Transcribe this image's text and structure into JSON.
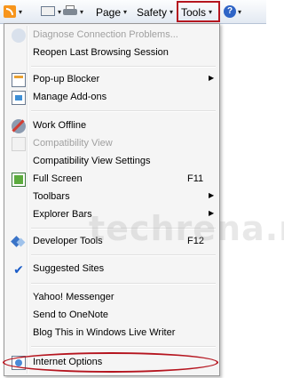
{
  "commandbar": {
    "page_label": "Page",
    "safety_label": "Safety",
    "tools_label": "Tools",
    "dropdown_arrow": "▾",
    "help_glyph": "?",
    "highlight_color": "#b5151f"
  },
  "menu": {
    "items": [
      {
        "label": "Diagnose Connection Problems...",
        "icon": "diagnose-icon",
        "disabled": true
      },
      {
        "label": "Reopen Last Browsing Session",
        "icon": null
      },
      {
        "label": "Pop-up Blocker",
        "icon": "popup-blocker-icon",
        "submenu": true
      },
      {
        "label": "Manage Add-ons",
        "icon": "manage-addons-icon"
      },
      {
        "label": "Work Offline",
        "icon": "work-offline-icon"
      },
      {
        "label": "Compatibility View",
        "icon": "compatibility-view-icon",
        "disabled": true
      },
      {
        "label": "Compatibility View Settings",
        "icon": null
      },
      {
        "label": "Full Screen",
        "icon": "full-screen-icon",
        "shortcut": "F11"
      },
      {
        "label": "Toolbars",
        "icon": null,
        "submenu": true
      },
      {
        "label": "Explorer Bars",
        "icon": null,
        "submenu": true
      },
      {
        "label": "Developer Tools",
        "icon": "developer-tools-icon",
        "shortcut": "F12"
      },
      {
        "label": "Suggested Sites",
        "icon": "check-icon",
        "checked": true
      },
      {
        "label": "Yahoo! Messenger",
        "icon": null
      },
      {
        "label": "Send to OneNote",
        "icon": null
      },
      {
        "label": "Blog This in Windows Live Writer",
        "icon": null
      },
      {
        "label": "Internet Options",
        "icon": "internet-options-icon",
        "highlighted": true
      }
    ],
    "submenu_arrow": "▶",
    "check_glyph": "✔"
  },
  "watermark": "techrena.net"
}
